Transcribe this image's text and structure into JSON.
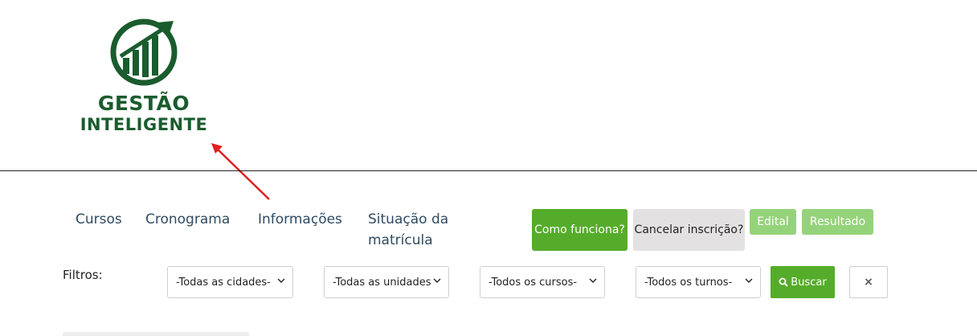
{
  "logo": {
    "line1": "GESTÃO",
    "line2": "INTELIGENTE",
    "color": "#1a5c2e"
  },
  "nav": {
    "cursos": "Cursos",
    "cronograma": "Cronograma",
    "informacoes": "Informações",
    "situacao": "Situação da matrícula"
  },
  "buttons": {
    "como": "Como funciona?",
    "cancelar": "Cancelar inscrição?",
    "edital": "Edital",
    "resultado": "Resultado"
  },
  "filters": {
    "label": "Filtros:",
    "cidades": "-Todas as cidades-",
    "unidades": "-Todas as unidades-",
    "cursos": "-Todos os cursos-",
    "turnos": "-Todos os turnos-",
    "buscar": "Buscar",
    "clear_icon": "×"
  },
  "colors": {
    "primary_green": "#55ac2a",
    "light_green": "#95d37a",
    "gray_button": "#e3e1e1",
    "nav_text": "#2f4a63",
    "annotation_arrow": "#e02020"
  },
  "icons": {
    "search": "search-icon",
    "clear": "close-icon",
    "chevron": "chevron-down-icon"
  }
}
